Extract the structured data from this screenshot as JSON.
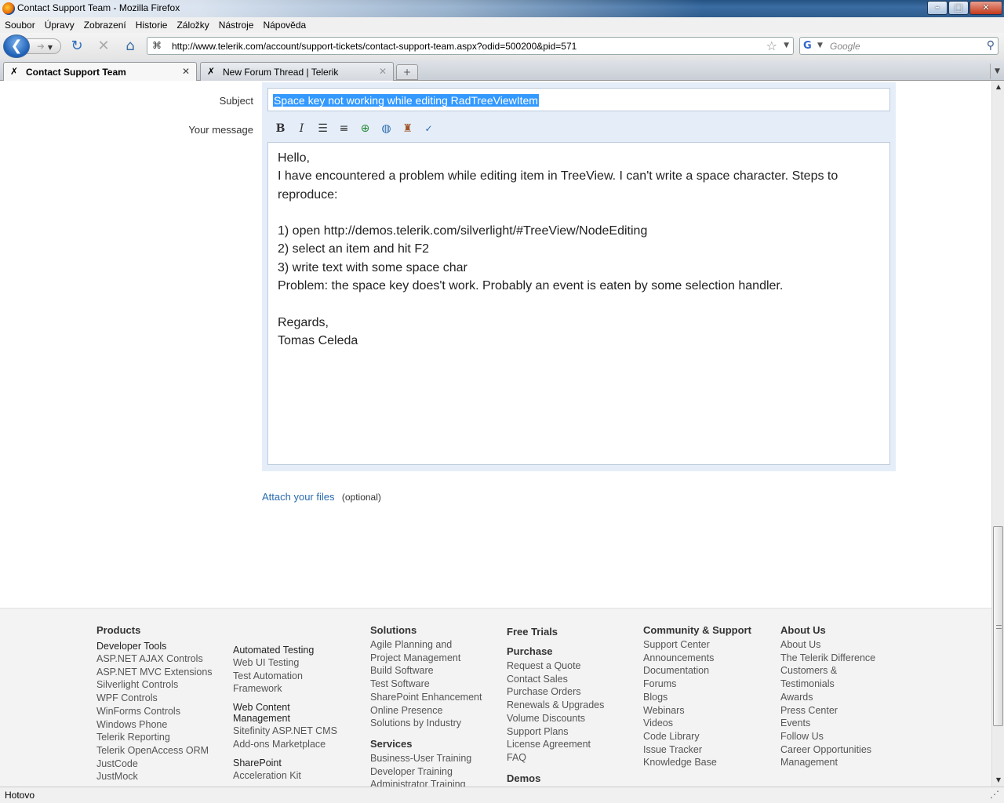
{
  "window": {
    "title": "Contact Support Team - Mozilla Firefox",
    "minimize": "–",
    "maximize": "□",
    "close": "✕"
  },
  "menu": [
    "Soubor",
    "Úpravy",
    "Zobrazení",
    "Historie",
    "Záložky",
    "Nástroje",
    "Nápověda"
  ],
  "nav": {
    "url": "http://www.telerik.com/account/support-tickets/contact-support-team.aspx?odid=500200&pid=571",
    "search_placeholder": "Google"
  },
  "tabs": [
    {
      "label": "Contact Support Team",
      "active": true
    },
    {
      "label": "New Forum Thread | Telerik",
      "active": false
    }
  ],
  "form": {
    "subject_label": "Subject",
    "subject_value": "Space key not working while editing RadTreeViewItem",
    "message_label": "Your message",
    "message_lines": [
      "Hello,",
      "I have encountered a problem while editing item in TreeView. I can't write a space character. Steps to",
      "reproduce:",
      "",
      "1) open http://demos.telerik.com/silverlight/#TreeView/NodeEditing",
      "2) select an item and hit F2",
      "3) write text with some space char",
      "Problem: the space key does't work. Probably an event is eaten by some selection handler.",
      "",
      "Regards,",
      "Tomas Celeda"
    ],
    "attach_link": "Attach your files",
    "attach_note": "(optional)"
  },
  "footer": {
    "products": {
      "title": "Products",
      "sub": "Developer Tools",
      "items": [
        "ASP.NET AJAX Controls",
        "ASP.NET MVC Extensions",
        "Silverlight Controls",
        "WPF Controls",
        "WinForms Controls",
        "Windows Phone",
        "Telerik Reporting",
        "Telerik OpenAccess ORM",
        "JustCode",
        "JustMock"
      ]
    },
    "automated": {
      "sub": "Automated Testing",
      "items": [
        "Web UI Testing",
        "Test Automation",
        "Framework"
      ],
      "sub2a": "Web Content",
      "sub2b": "Management",
      "items2": [
        "Sitefinity ASP.NET CMS",
        "Add-ons Marketplace"
      ],
      "sub3": "SharePoint",
      "items3": [
        "Acceleration Kit"
      ]
    },
    "solutions": {
      "title": "Solutions",
      "items": [
        "Agile Planning and",
        "Project Management",
        "Build Software",
        "Test Software",
        "SharePoint Enhancement",
        "Online Presence",
        "Solutions by Industry"
      ],
      "title2": "Services",
      "items2": [
        "Business-User Training",
        "Developer Training",
        "Administrator Training"
      ]
    },
    "trials": {
      "title": "Free Trials",
      "title2": "Purchase",
      "items": [
        "Request a Quote",
        "Contact Sales",
        "Purchase Orders",
        "Renewals & Upgrades",
        "Volume Discounts",
        "Support Plans",
        "License Agreement",
        "FAQ"
      ],
      "title3": "Demos"
    },
    "community": {
      "title": "Community & Support",
      "items": [
        "Support Center",
        "Announcements",
        "Documentation",
        "Forums",
        "Blogs",
        "Webinars",
        "Videos",
        "Code Library",
        "Issue Tracker",
        "Knowledge Base"
      ]
    },
    "about": {
      "title": "About Us",
      "items": [
        "About Us",
        "The Telerik Difference",
        "Customers &",
        "Testimonials",
        "Awards",
        "Press Center",
        "Events",
        "Follow Us",
        "Career Opportunities",
        "Management"
      ]
    }
  },
  "status": {
    "text": "Hotovo"
  }
}
